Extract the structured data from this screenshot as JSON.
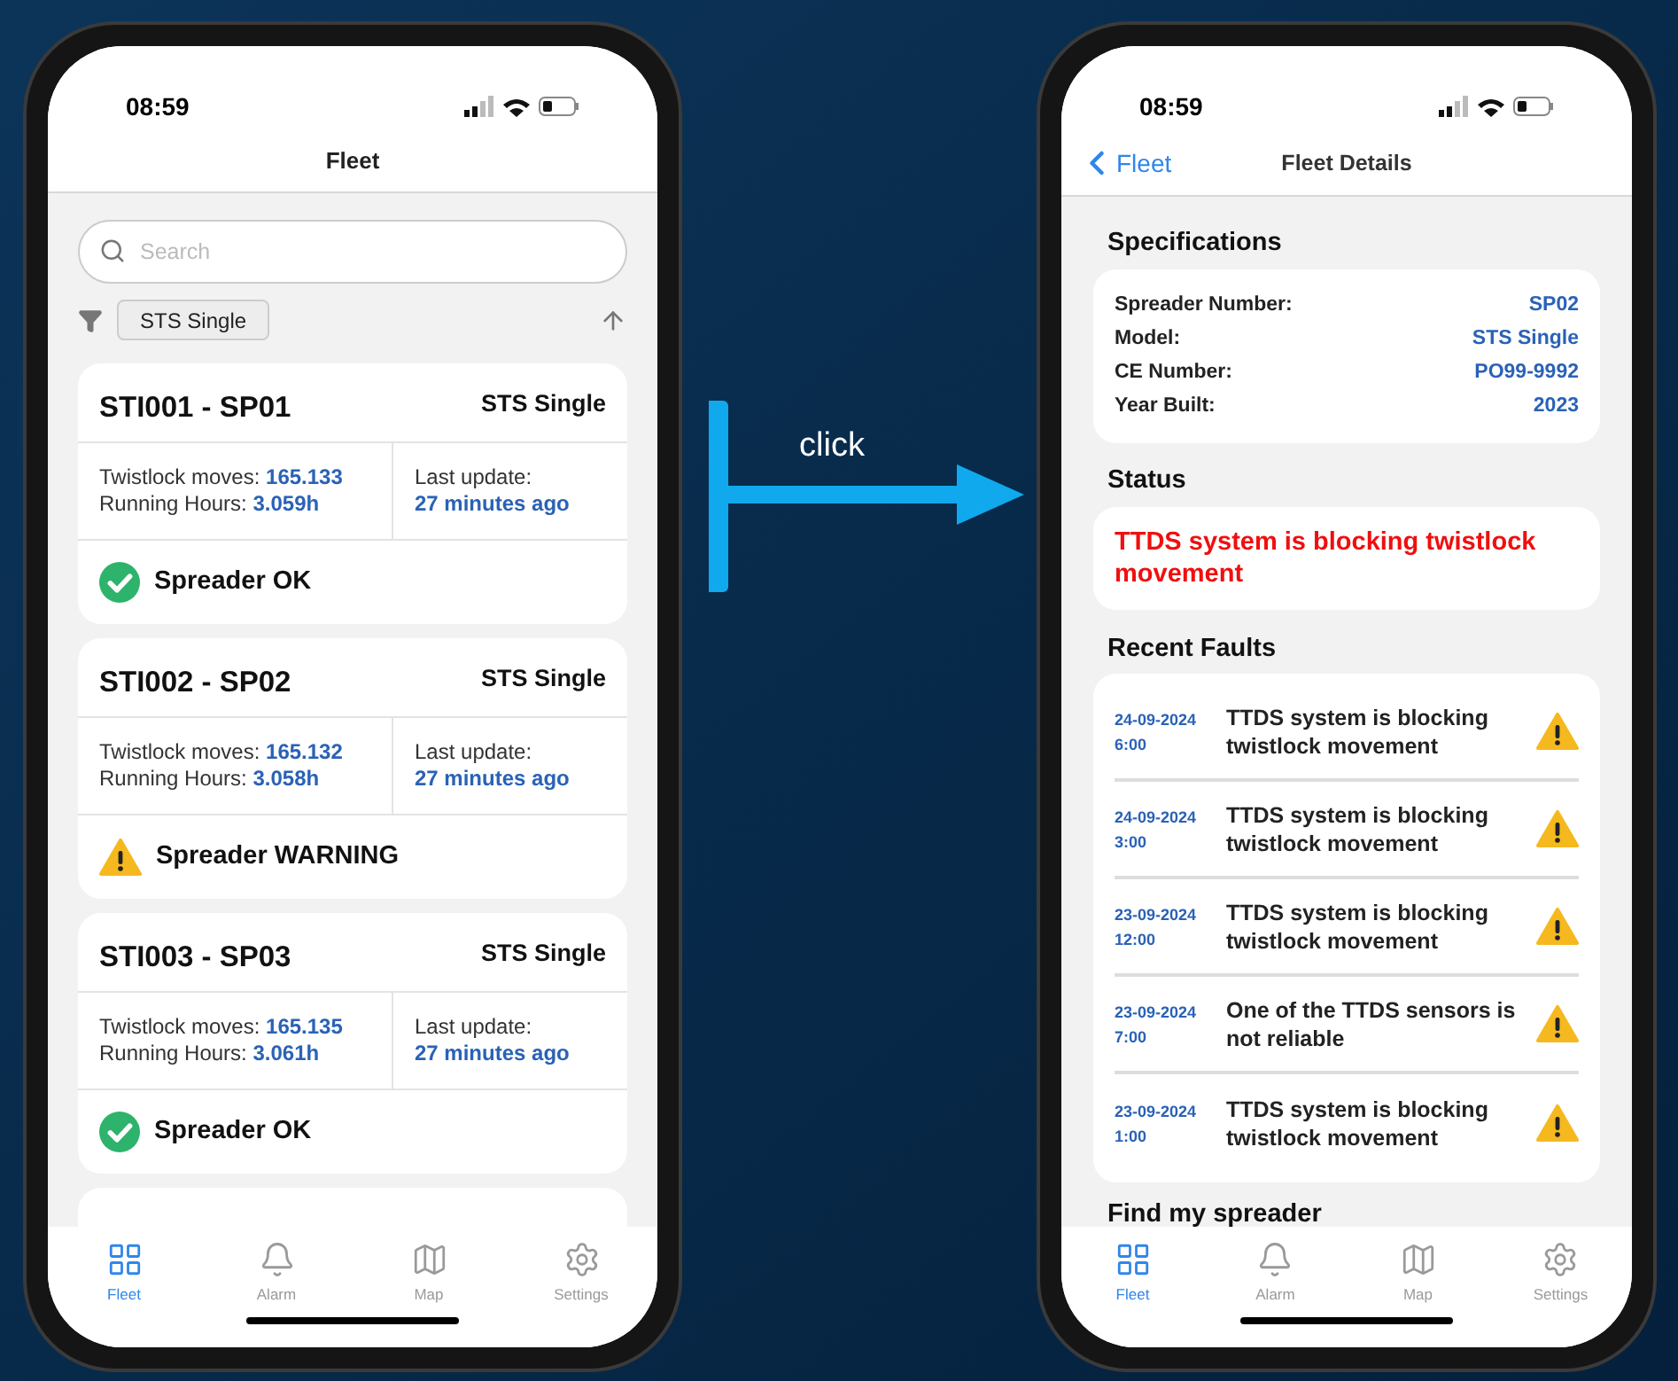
{
  "fleet_screen": {
    "status_bar": {
      "time": "08:59"
    },
    "title": "Fleet",
    "search": {
      "placeholder": "Search"
    },
    "filter_chip": "STS Single",
    "cards": [
      {
        "name": "STI001 - SP01",
        "model": "STS Single",
        "moves_label": "Twistlock moves:",
        "moves": "165.133",
        "hours_label": "Running Hours:",
        "hours": "3.059h",
        "update_label": "Last update:",
        "update": "27 minutes ago",
        "status": "Spreader OK",
        "kind": "ok"
      },
      {
        "name": "STI002 - SP02",
        "model": "STS Single",
        "moves_label": "Twistlock moves:",
        "moves": "165.132",
        "hours_label": "Running Hours:",
        "hours": "3.058h",
        "update_label": "Last update:",
        "update": "27 minutes ago",
        "status": "Spreader WARNING",
        "kind": "warning"
      },
      {
        "name": "STI003 - SP03",
        "model": "STS Single",
        "moves_label": "Twistlock moves:",
        "moves": "165.135",
        "hours_label": "Running Hours:",
        "hours": "3.061h",
        "update_label": "Last update:",
        "update": "27 minutes ago",
        "status": "Spreader OK",
        "kind": "ok"
      }
    ],
    "tab_bar": [
      {
        "label": "Fleet",
        "selected": true
      },
      {
        "label": "Alarm",
        "selected": false
      },
      {
        "label": "Map",
        "selected": false
      },
      {
        "label": "Settings",
        "selected": false
      }
    ]
  },
  "arrow": {
    "label": "click"
  },
  "details_screen": {
    "status_bar": {
      "time": "08:59"
    },
    "back": "Fleet",
    "title": "Fleet Details",
    "specifications": {
      "heading": "Specifications",
      "rows": [
        {
          "label": "Spreader Number:",
          "value": "SP02"
        },
        {
          "label": "Model:",
          "value": "STS Single"
        },
        {
          "label": "CE Number:",
          "value": "PO99-9992"
        },
        {
          "label": "Year Built:",
          "value": "2023"
        }
      ]
    },
    "status": {
      "heading": "Status",
      "message": "TTDS system is blocking twistlock movement"
    },
    "recent_faults": {
      "heading": "Recent Faults",
      "items": [
        {
          "date": "24-09-2024",
          "time": "6:00",
          "text": "TTDS system is blocking twistlock movement"
        },
        {
          "date": "24-09-2024",
          "time": "3:00",
          "text": "TTDS system is blocking twistlock movement"
        },
        {
          "date": "23-09-2024",
          "time": "12:00",
          "text": "TTDS system is blocking twistlock movement"
        },
        {
          "date": "23-09-2024",
          "time": "7:00",
          "text": "One of the TTDS sensors is not reliable"
        },
        {
          "date": "23-09-2024",
          "time": "1:00",
          "text": "TTDS system is blocking twistlock movement"
        }
      ]
    },
    "next_heading": "Find my spreader",
    "tab_bar": [
      {
        "label": "Fleet",
        "selected": true
      },
      {
        "label": "Alarm",
        "selected": false
      },
      {
        "label": "Map",
        "selected": false
      },
      {
        "label": "Settings",
        "selected": false
      }
    ]
  }
}
